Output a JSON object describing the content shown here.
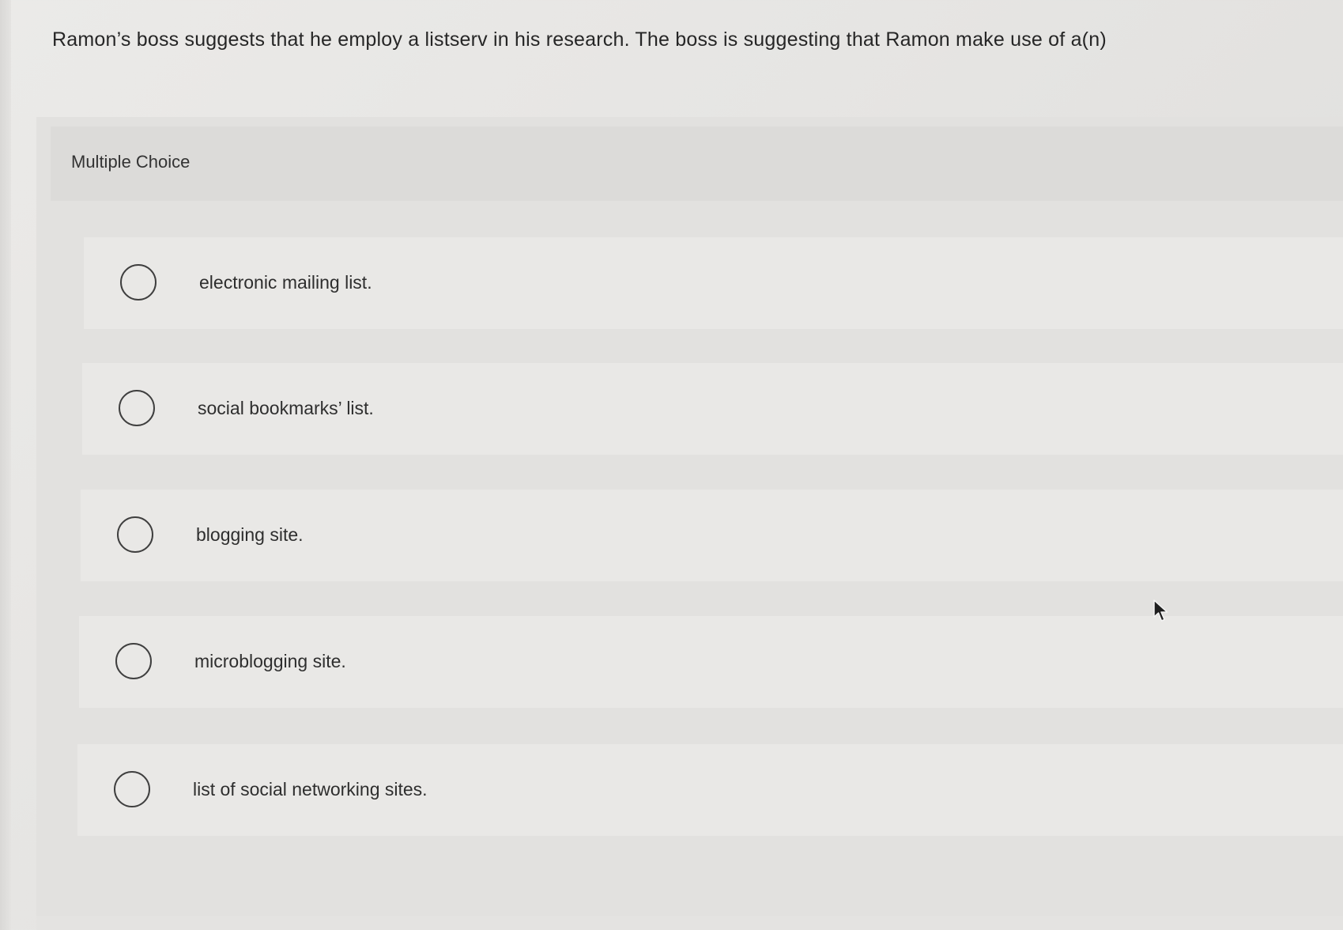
{
  "question": {
    "text": "Ramon’s boss suggests that he employ a listserv in his research. The boss is suggesting that Ramon make use of a(n)"
  },
  "panel": {
    "title": "Multiple Choice"
  },
  "options": [
    {
      "label": "electronic mailing list.",
      "selected": false
    },
    {
      "label": "social bookmarks’ list.",
      "selected": false
    },
    {
      "label": "blogging site.",
      "selected": false
    },
    {
      "label": "microblogging site.",
      "selected": false
    },
    {
      "label": "list of social networking sites.",
      "selected": false
    }
  ],
  "icons": {
    "radio": "radio-unselected-icon",
    "cursor": "mouse-pointer-icon"
  },
  "colors": {
    "page_background": "#e8e7e5",
    "option_background": "#e9e8e6",
    "radio_border": "#3f3f3f",
    "text": "#2b2b2b"
  }
}
